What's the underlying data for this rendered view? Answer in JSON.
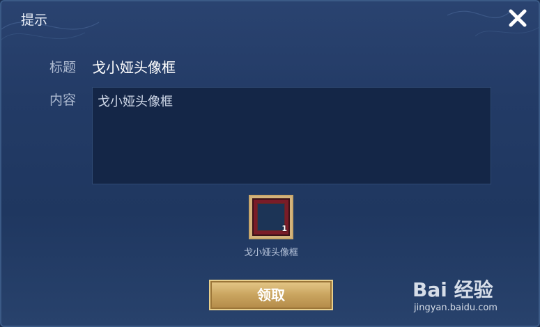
{
  "dialog": {
    "title": "提示",
    "close_icon": "close-icon"
  },
  "mail": {
    "title_label": "标题",
    "title_value": "戈小娅头像框",
    "content_label": "内容",
    "content_value": "戈小娅头像框"
  },
  "reward": {
    "icon": "avatar-frame-icon",
    "name": "戈小娅头像框",
    "count": "1"
  },
  "actions": {
    "claim_label": "领取"
  },
  "watermark": {
    "brand": "Bai 经验",
    "url": "jingyan.baidu.com"
  },
  "colors": {
    "background": "#233b66",
    "content_box": "#142647",
    "button_gold": "#c9a45f"
  }
}
